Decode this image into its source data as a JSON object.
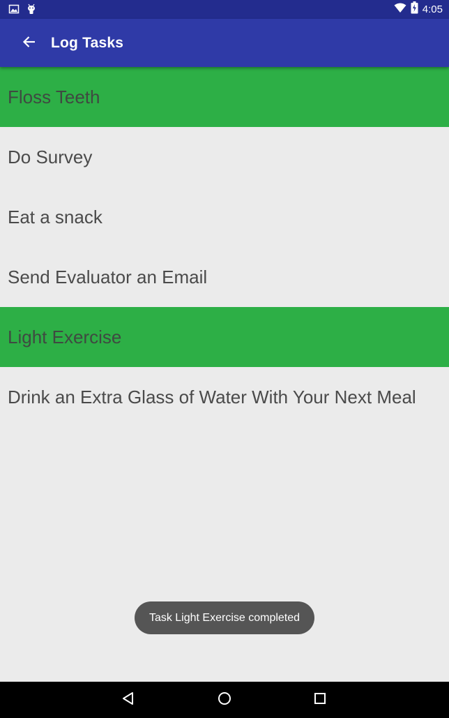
{
  "status_bar": {
    "time": "4:05",
    "icons": [
      "image-notification-icon",
      "android-debug-icon",
      "wifi-icon",
      "battery-charging-icon"
    ]
  },
  "app_bar": {
    "title": "Log Tasks",
    "back_icon": "arrow-back-icon"
  },
  "tasks": [
    {
      "label": "Floss Teeth",
      "completed": true
    },
    {
      "label": "Do Survey",
      "completed": false
    },
    {
      "label": "Eat a snack",
      "completed": false
    },
    {
      "label": "Send Evaluator an Email",
      "completed": false
    },
    {
      "label": "Light Exercise",
      "completed": true
    },
    {
      "label": "Drink an Extra Glass of Water With Your Next Meal",
      "completed": false
    }
  ],
  "toast": {
    "message": "Task Light Exercise completed"
  },
  "nav_bar": {
    "buttons": [
      "back-triangle-icon",
      "home-circle-icon",
      "recents-square-icon"
    ]
  },
  "colors": {
    "status_bar": "#232c8e",
    "app_bar": "#2f3aa7",
    "completed_row": "#2daf46",
    "background": "#ebebeb",
    "toast": "#555555"
  }
}
